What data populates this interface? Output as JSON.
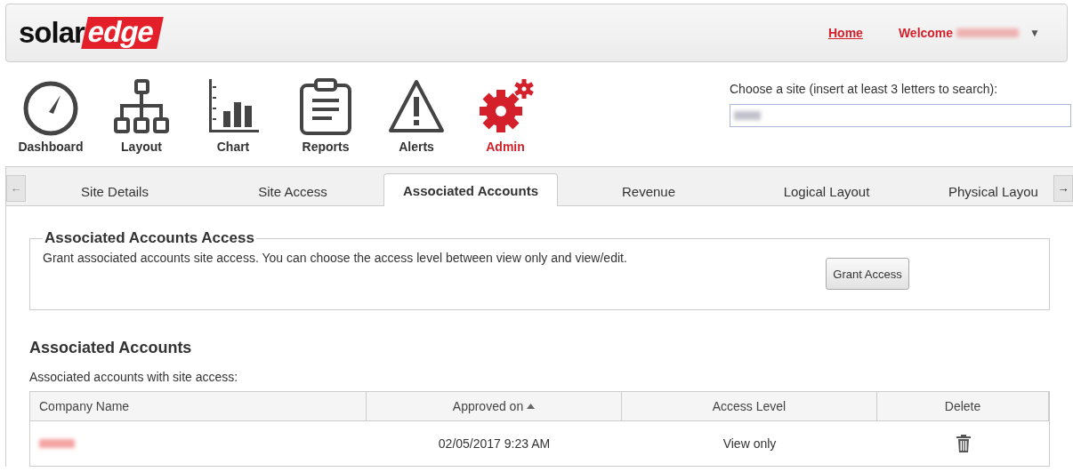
{
  "header": {
    "logo": {
      "dark": "solar",
      "highlight": "edge"
    },
    "home_link": "Home",
    "welcome": "Welcome",
    "menu_caret": "▼"
  },
  "nav": [
    {
      "kind": "dashboard",
      "label": "Dashboard",
      "selected": false
    },
    {
      "kind": "layout",
      "label": "Layout",
      "selected": false
    },
    {
      "kind": "chart",
      "label": "Chart",
      "selected": false
    },
    {
      "kind": "reports",
      "label": "Reports",
      "selected": false
    },
    {
      "kind": "alerts",
      "label": "Alerts",
      "selected": false
    },
    {
      "kind": "admin",
      "label": "Admin",
      "selected": true
    }
  ],
  "site_search": {
    "label": "Choose a site (insert at least 3 letters to search):"
  },
  "tab_scroll": {
    "left": "←",
    "right": "→",
    "left_enabled": false,
    "right_enabled": true
  },
  "tabs": [
    {
      "label": "Site Details",
      "selected": false
    },
    {
      "label": "Site Access",
      "selected": false
    },
    {
      "label": "Associated Accounts",
      "selected": true
    },
    {
      "label": "Revenue",
      "selected": false
    },
    {
      "label": "Logical Layout",
      "selected": false
    },
    {
      "label": "Physical Layou",
      "selected": false
    }
  ],
  "access_panel": {
    "legend": "Associated Accounts Access",
    "text": "Grant associated accounts site access. You can choose the access level between view only and view/edit.",
    "button": "Grant Access"
  },
  "accounts": {
    "heading": "Associated Accounts",
    "caption": "Associated accounts with site access:",
    "columns": [
      {
        "label": "Company Name",
        "sorted": false
      },
      {
        "label": "Approved on",
        "sorted": true
      },
      {
        "label": "Access Level",
        "sorted": false
      },
      {
        "label": "Delete",
        "sorted": false
      }
    ],
    "rows": [
      {
        "approved_on": "02/05/2017 9:23 AM",
        "access_level": "View only"
      }
    ]
  }
}
